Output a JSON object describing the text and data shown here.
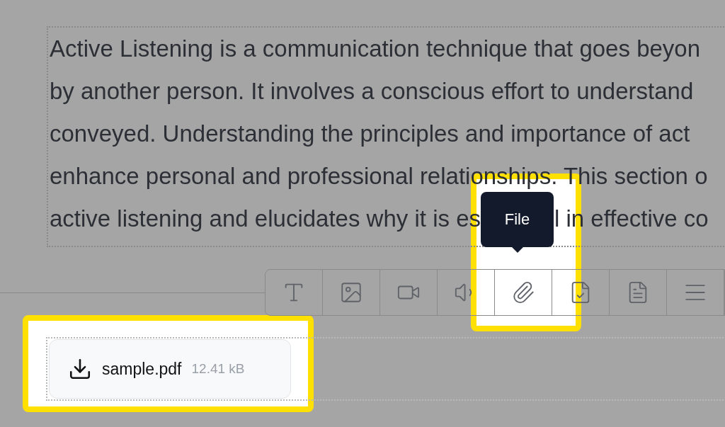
{
  "editor": {
    "lines": [
      "Active Listening is a communication technique that goes beyon",
      "by another person. It involves a conscious effort to understand",
      "conveyed. Understanding the principles and importance of act",
      "enhance personal and professional relationships. This section o"
    ],
    "last_line": [
      "active listening and elucidates why it is es",
      "l in effective co"
    ]
  },
  "toolbar": {
    "tools": [
      {
        "kind": "text"
      },
      {
        "kind": "image"
      },
      {
        "kind": "video"
      },
      {
        "kind": "audio"
      },
      {
        "kind": "attachment"
      },
      {
        "kind": "quiz"
      },
      {
        "kind": "document"
      },
      {
        "kind": "list"
      }
    ],
    "tooltip": "File"
  },
  "attachment": {
    "name": "sample.pdf",
    "size": "12.41 kB"
  }
}
